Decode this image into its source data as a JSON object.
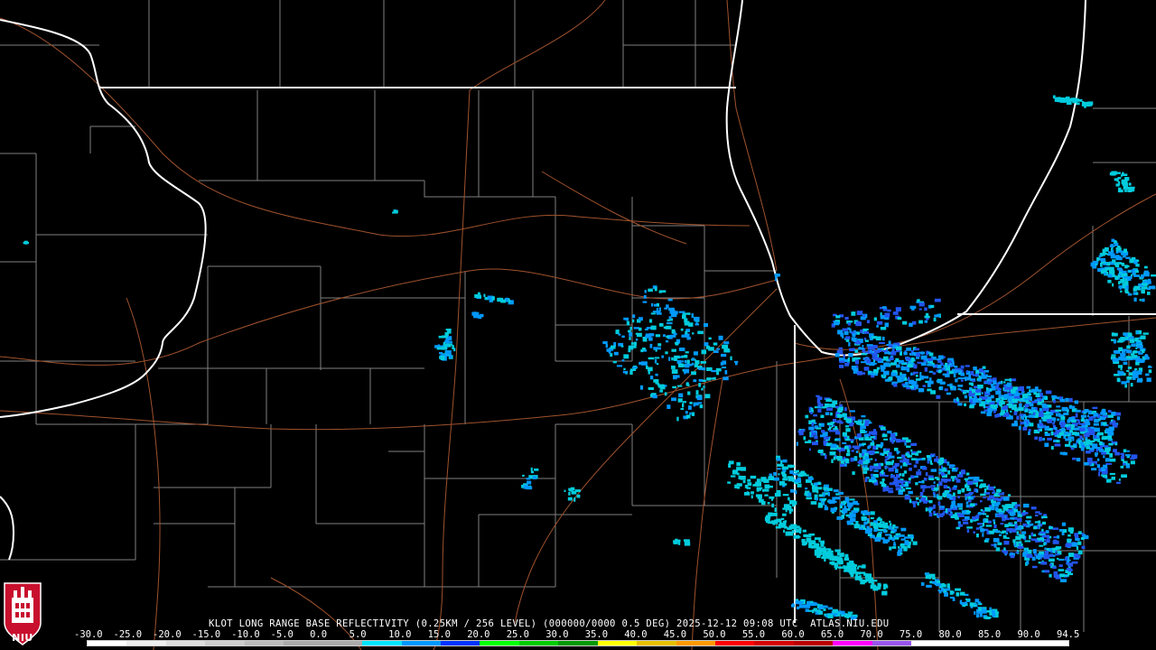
{
  "product": {
    "station": "KLOT",
    "line": "KLOT LONG RANGE BASE REFLECTIVITY (0.25KM / 256 LEVEL) (000000/0000 0.5 DEG) 2025-12-12 09:08 UTC  ATLAS.NIU.EDU"
  },
  "logo": {
    "text": "NIU",
    "color": "#c8102e"
  },
  "colorscale": {
    "labels": [
      "-30.0",
      "-25.0",
      "-20.0",
      "-15.0",
      "-10.0",
      "-5.0",
      "0.0",
      "5.0",
      "10.0",
      "15.0",
      "20.0",
      "25.0",
      "30.0",
      "35.0",
      "40.0",
      "45.0",
      "50.0",
      "55.0",
      "60.0",
      "65.0",
      "70.0",
      "75.0",
      "80.0",
      "85.0",
      "90.0",
      "94.5"
    ],
    "colors": [
      "#ffffff",
      "#eeeeee",
      "#dddddd",
      "#cccccc",
      "#bbbbbb",
      "#aaaaaa",
      "#aaaaaa",
      "#00e5ff",
      "#0099ff",
      "#0033ff",
      "#00ff00",
      "#00cc00",
      "#009900",
      "#ffff00",
      "#e6c000",
      "#ff9900",
      "#ff0000",
      "#d40000",
      "#bb0000",
      "#ff00ff",
      "#9955ee",
      "#ffffff",
      "#ffffff",
      "#ffffff",
      "#ffffff"
    ]
  },
  "map_colors": {
    "state_border": "#ffffff",
    "county_line": "#808080",
    "highway": "#a0522d",
    "echo_light": "#00ccdd",
    "echo_mid": "#0099ff",
    "echo_strong": "#2255ee"
  }
}
